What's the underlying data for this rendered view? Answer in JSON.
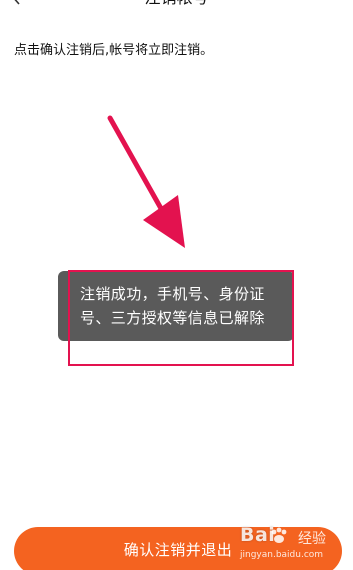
{
  "header": {
    "title": "注销帐号",
    "back_icon": "chevron-left-icon"
  },
  "main": {
    "description": "点击确认注销后,帐号将立即注销。"
  },
  "toast": {
    "line1": "注销成功，手机号、身份证",
    "line2": "号、三方授权等信息已解除"
  },
  "footer": {
    "confirm_label": "确认注销并退出"
  },
  "watermark": {
    "brand": "Bai",
    "brand_suffix": "经验",
    "url": "jingyan.baidu.com"
  },
  "colors": {
    "accent": "#f46320",
    "annotation": "#e3124f",
    "toast_bg": "#5a5a5a"
  }
}
